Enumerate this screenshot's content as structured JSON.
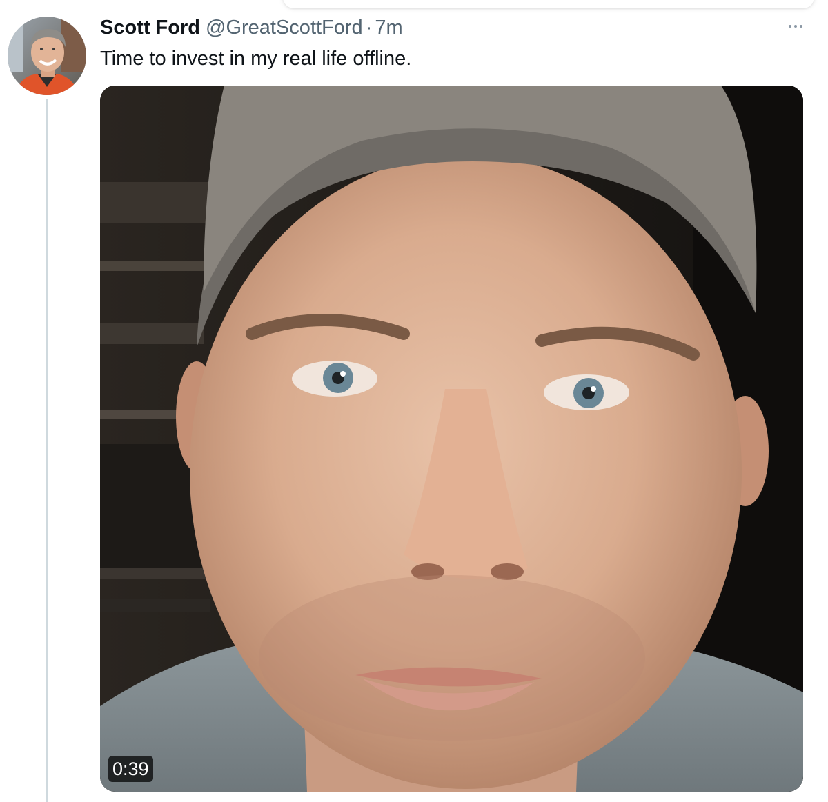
{
  "tweet": {
    "author_name": "Scott Ford",
    "handle": "@GreatScottFord",
    "separator": "·",
    "timestamp": "7m",
    "text": "Time to invest in my real life offline."
  },
  "media": {
    "type": "video",
    "duration": "0:39"
  },
  "icons": {
    "more": "more-horizontal-icon"
  },
  "colors": {
    "text_primary": "#0f1419",
    "text_secondary": "#536471",
    "thread_line": "#cfd9de"
  }
}
